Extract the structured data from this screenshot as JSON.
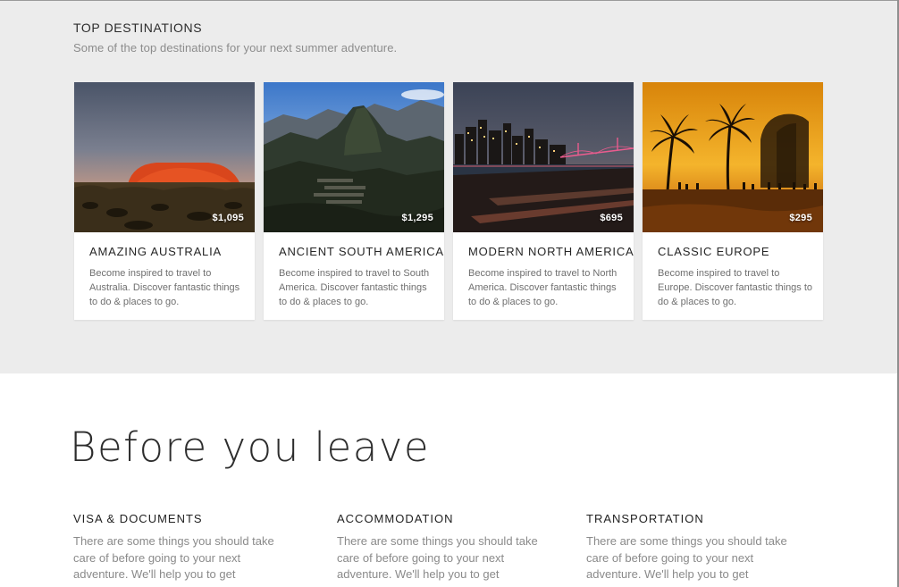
{
  "top_destinations": {
    "title": "TOP DESTINATIONS",
    "subtitle": "Some of the top destinations for your next summer adventure.",
    "cards": [
      {
        "title": "AMAZING AUSTRALIA",
        "price": "$1,095",
        "description": "Become inspired to travel to Australia. Discover fantastic things to do & places to go.",
        "image_icon": "uluru-photo"
      },
      {
        "title": "ANCIENT SOUTH AMERICA",
        "price": "$1,295",
        "description": "Become inspired to travel to South America. Discover fantastic things to do & places to go.",
        "image_icon": "machu-picchu-photo"
      },
      {
        "title": "MODERN NORTH AMERICA",
        "price": "$695",
        "description": "Become inspired to travel to North America. Discover fantastic things to do & places to go.",
        "image_icon": "city-skyline-photo"
      },
      {
        "title": "CLASSIC EUROPE",
        "price": "$295",
        "description": "Become inspired to travel to Europe. Discover fantastic things to do & places to go.",
        "image_icon": "palm-beach-sunset-photo"
      }
    ]
  },
  "before_you_leave": {
    "heading": "Before you leave",
    "columns": [
      {
        "title": "VISA & DOCUMENTS",
        "text": "There are some things you should take care of before going to your next adventure. We'll help you to get"
      },
      {
        "title": "ACCOMMODATION",
        "text": "There are some things you should take care of before going to your next adventure. We'll help you to get"
      },
      {
        "title": "TRANSPORTATION",
        "text": "There are some things you should take care of before going to your next adventure. We'll help you to get"
      }
    ]
  },
  "colors": {
    "band_background": "#ececec",
    "card_background": "#ffffff",
    "heading_text": "#2b2b2b",
    "muted_text": "#8c8c8c"
  }
}
